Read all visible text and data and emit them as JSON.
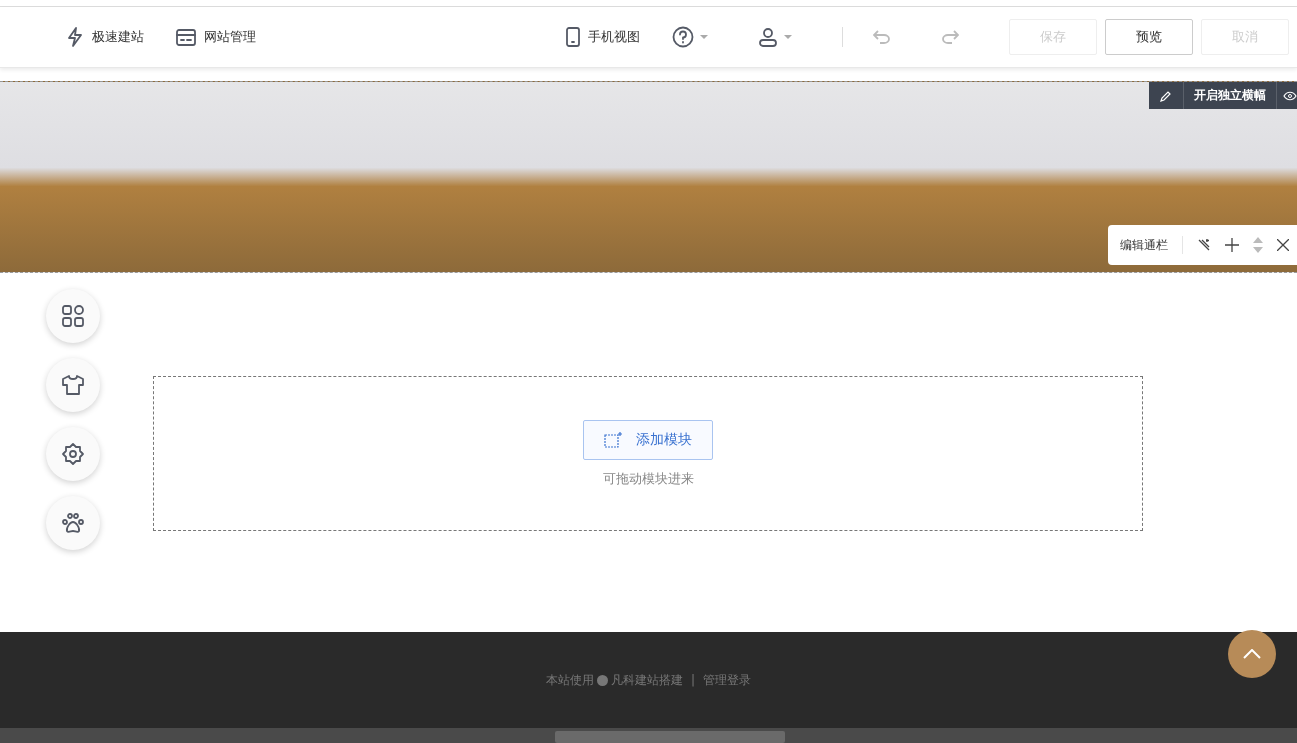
{
  "toolbar": {
    "left_items": [
      {
        "label": "极速建站",
        "kind": "bolt"
      },
      {
        "label": "网站管理",
        "kind": "site"
      }
    ],
    "mobile_view": "手机视图",
    "history": [
      {
        "kind": "undo",
        "disabled": true
      },
      {
        "kind": "redo",
        "disabled": true
      }
    ],
    "buttons": [
      {
        "label": "保存",
        "disabled": true
      },
      {
        "label": "预览",
        "disabled": false
      },
      {
        "label": "取消",
        "disabled": true
      }
    ]
  },
  "banner": {
    "top_bar": {
      "label": "开启独立横幅"
    },
    "edit_bar": {
      "label": "编辑通栏"
    }
  },
  "side_tools": [
    {
      "kind": "apps"
    },
    {
      "kind": "shirt"
    },
    {
      "kind": "gear"
    },
    {
      "kind": "paw"
    }
  ],
  "drop_zone": {
    "button": "添加模块",
    "hint": "可拖动模块进来"
  },
  "footer": {
    "prefix": "本站使用",
    "brand": "凡科建站搭建",
    "separator": "|",
    "login": "管理登录"
  }
}
